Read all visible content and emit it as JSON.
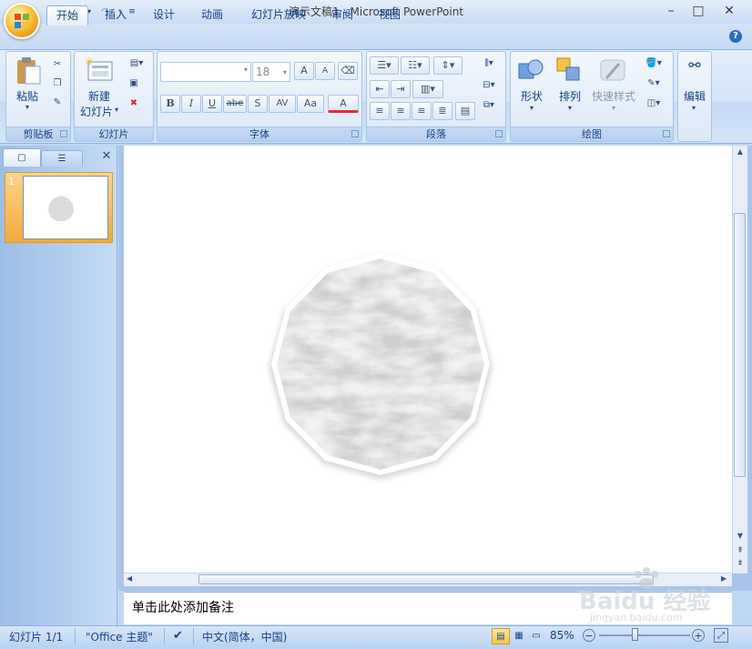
{
  "window": {
    "title": "演示文稿1 - Microsoft PowerPoint",
    "minimize_glyph": "–",
    "maximize_glyph": "□",
    "close_glyph": "✕"
  },
  "quick_access": {
    "save_icon": "save-icon",
    "undo_icon": "undo-icon",
    "redo_icon": "redo-icon",
    "customize_icon": "customize-qat-icon"
  },
  "tabs": [
    {
      "label": "开始",
      "active": true
    },
    {
      "label": "插入",
      "active": false
    },
    {
      "label": "设计",
      "active": false
    },
    {
      "label": "动画",
      "active": false
    },
    {
      "label": "幻灯片放映",
      "active": false
    },
    {
      "label": "审阅",
      "active": false
    },
    {
      "label": "视图",
      "active": false
    }
  ],
  "ribbon": {
    "clipboard": {
      "group_label": "剪贴板",
      "paste_label": "粘贴"
    },
    "slides": {
      "group_label": "幻灯片",
      "new_slide_line1": "新建",
      "new_slide_line2": "幻灯片"
    },
    "font": {
      "group_label": "字体",
      "font_name_value": "",
      "font_size_value": "18",
      "bold": "B",
      "italic": "I",
      "underline": "U",
      "strike": "abe",
      "shadow": "S",
      "spacing": "AV",
      "case": "Aa",
      "color": "A",
      "grow": "A",
      "shrink": "A"
    },
    "paragraph": {
      "group_label": "段落"
    },
    "drawing": {
      "group_label": "绘图",
      "shape_label": "形状",
      "arrange_label": "排列",
      "quick_styles_label": "快速样式"
    },
    "editing": {
      "label": "编辑"
    }
  },
  "slides_panel": {
    "slide_number": "1",
    "close_glyph": "✕"
  },
  "notes": {
    "placeholder": "单击此处添加备注"
  },
  "status_bar": {
    "slide_info": "幻灯片 1/1",
    "theme": "\"Office 主题\"",
    "language": "中文(简体，中国)",
    "zoom": "85%"
  },
  "watermark": {
    "text": "Baidu 经验",
    "subtext": "jingyan.baidu.com"
  },
  "colors": {
    "accent": "#15428b",
    "ribbon_bg": "#d5e5f8",
    "selected_thumb": "#f4a93d"
  }
}
